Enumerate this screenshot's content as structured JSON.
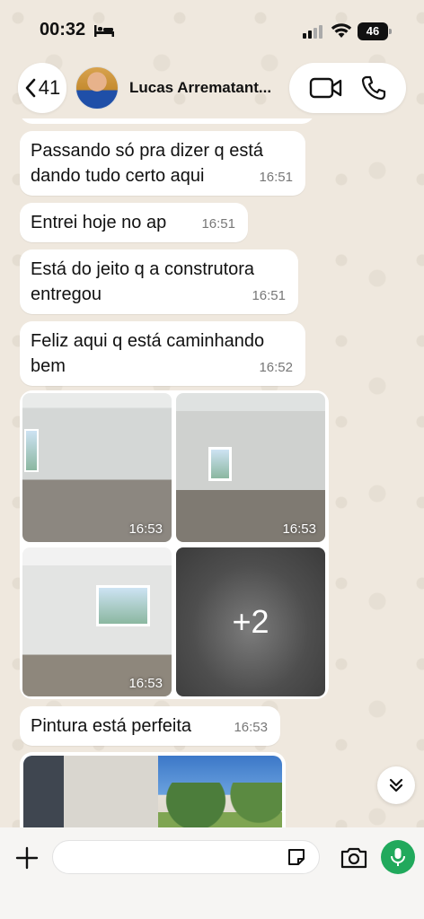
{
  "status_bar": {
    "time": "00:32",
    "battery": "46"
  },
  "header": {
    "back_count": "41",
    "contact_name": "Lucas Arrematant..."
  },
  "messages": [
    {
      "text": "Passando só pra dizer q está dando tudo certo aqui",
      "time": "16:51"
    },
    {
      "text": "Entrei hoje no ap",
      "time": "16:51"
    },
    {
      "text": "Está do jeito q a construtora entregou",
      "time": "16:51"
    },
    {
      "text": "Feliz aqui q está caminhando bem",
      "time": "16:52"
    }
  ],
  "media_album": {
    "times": [
      "16:53",
      "16:53",
      "16:53"
    ],
    "more_count": "+2"
  },
  "last_message": {
    "text": "Pintura está perfeita",
    "time": "16:53"
  },
  "composer": {
    "placeholder": ""
  },
  "colors": {
    "accent_green": "#21a95c",
    "bubble": "#ffffff",
    "wallpaper": "#efe8de"
  }
}
